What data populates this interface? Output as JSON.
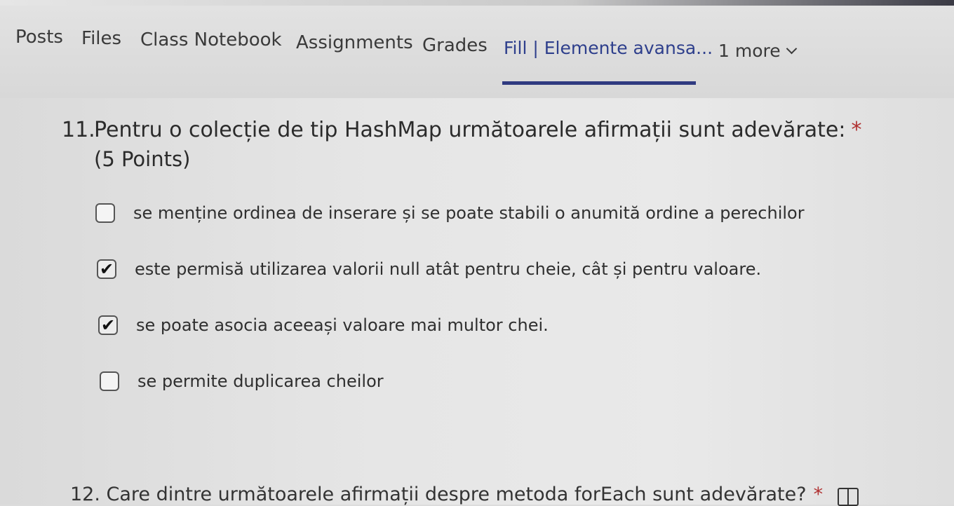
{
  "tabs": [
    {
      "label": "Posts"
    },
    {
      "label": "Files"
    },
    {
      "label": "Class Notebook"
    },
    {
      "label": "Assignments"
    },
    {
      "label": "Grades"
    },
    {
      "label": "Fill | Elemente avansa..."
    },
    {
      "label": "1 more"
    }
  ],
  "active_tab_index": 5,
  "question11": {
    "number": "11.",
    "text": "Pentru o colecție de tip HashMap următoarele afirmații sunt adevărate:",
    "required_mark": "*",
    "points": "(5 Points)",
    "options": [
      {
        "label": "se menține ordinea de inserare și se poate stabili o anumită ordine a perechilor",
        "checked": false,
        "mark": ""
      },
      {
        "label": "este permisă utilizarea valorii null atât pentru cheie, cât și pentru valoare.",
        "checked": true,
        "mark": "✔"
      },
      {
        "label": "se poate asocia aceeași valoare mai multor chei.",
        "checked": true,
        "mark": "✔"
      },
      {
        "label": "se permite duplicarea cheilor",
        "checked": false,
        "mark": ""
      }
    ]
  },
  "question12": {
    "text": "12. Care dintre următoarele afirmații despre metoda forEach sunt adevărate?",
    "required_mark": "*"
  },
  "icons": {
    "more_tabs": "chevron-down-icon",
    "immersive_reader": "immersive-reader-icon",
    "checkbox_checked": "checkmark-icon"
  },
  "colors": {
    "active_tab": "#2e3f8c",
    "tab_underline": "#303a80",
    "required": "#b03030"
  }
}
